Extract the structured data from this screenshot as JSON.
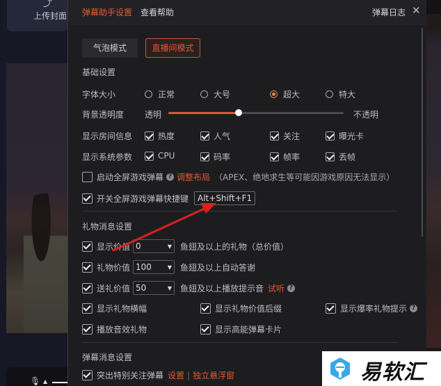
{
  "background": {
    "upload_cover_label": "上传封面"
  },
  "header": {
    "tabs": [
      {
        "label": "弹幕助手设置",
        "active": true
      },
      {
        "label": "查看帮助",
        "active": false
      }
    ],
    "log_link": "弹幕日志",
    "close_icon": "close-icon"
  },
  "modes": [
    {
      "label": "气泡模式",
      "active": false
    },
    {
      "label": "直播间模式",
      "active": true
    }
  ],
  "basic": {
    "title": "基础设置",
    "font_size": {
      "label": "字体大小",
      "options": [
        "正常",
        "大号",
        "超大",
        "特大"
      ],
      "selected": "超大"
    },
    "opacity": {
      "label": "背景透明度",
      "min_label": "透明",
      "max_label": "不透明",
      "value_percent": 40
    },
    "room_info": {
      "label": "显示房间信息",
      "items": [
        {
          "label": "热度",
          "checked": true
        },
        {
          "label": "人气",
          "checked": true
        },
        {
          "label": "关注",
          "checked": true
        },
        {
          "label": "曝光卡",
          "checked": true
        }
      ]
    },
    "system_params": {
      "label": "显示系统参数",
      "items": [
        {
          "label": "CPU",
          "checked": true
        },
        {
          "label": "码率",
          "checked": true
        },
        {
          "label": "帧率",
          "checked": true
        },
        {
          "label": "丢帧",
          "checked": true
        }
      ]
    },
    "fullscreen_game": {
      "label": "启动全屏游戏弹幕",
      "checked": false,
      "adjust_link": "调整布局",
      "note": "（APEX、绝地求生等可能因游戏原因无法显示）"
    },
    "hotkey": {
      "label": "开关全屏游戏弹幕快捷键",
      "checked": true,
      "value": "Alt+Shift+F1"
    }
  },
  "gift": {
    "title": "礼物消息设置",
    "rows": [
      {
        "label": "显示价值",
        "checked": true,
        "value": "0",
        "suffix": "鱼翅及以上的礼物（总价值）"
      },
      {
        "label": "礼物价值",
        "checked": true,
        "value": "100",
        "suffix": "鱼翅及以上自动答谢"
      },
      {
        "label": "送礼价值",
        "checked": true,
        "value": "50",
        "suffix": "鱼翅及以上播放提示音",
        "link": "试听"
      }
    ],
    "toggles": [
      {
        "label": "显示礼物横幅",
        "checked": true
      },
      {
        "label": "显示礼物价值后缀",
        "checked": true
      },
      {
        "label": "显示爆率礼物提示",
        "checked": true
      },
      {
        "label": "播放音效礼物",
        "checked": true
      },
      {
        "label": "显示高能弹幕卡片",
        "checked": true
      }
    ]
  },
  "danmaku": {
    "title": "弹幕消息设置",
    "highlight": {
      "label": "突出特别关注弹幕",
      "checked": true,
      "settings_link": "设置",
      "float_link": "独立悬浮窗"
    }
  },
  "watermark": {
    "text": "易软汇"
  },
  "colors": {
    "accent": "#e0592f",
    "dialog_bg": "#1d1d20",
    "header_bg": "#222226"
  }
}
